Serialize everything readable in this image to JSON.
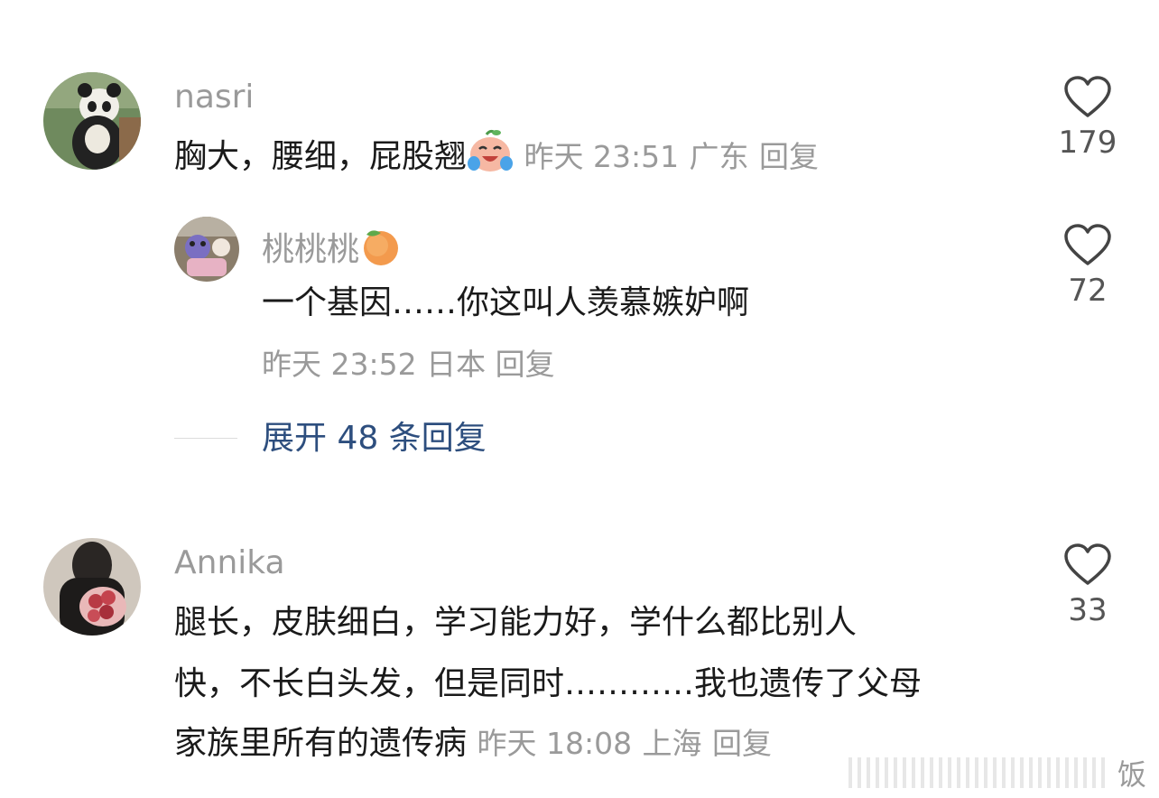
{
  "comments": [
    {
      "username": "nasri",
      "text": "胸大，腰细，屁股翘",
      "emoji": "crying-laugh-emoji",
      "time": "昨天 23:51",
      "location": "广东",
      "reply_label": "回复",
      "likes": "179",
      "replies": [
        {
          "username": "桃桃桃",
          "name_emoji": "peach-emoji",
          "text": "一个基因……你这叫人羡慕嫉妒啊",
          "time": "昨天 23:52",
          "location": "日本",
          "reply_label": "回复",
          "likes": "72"
        }
      ],
      "expand_label": "展开 48 条回复"
    },
    {
      "username": "Annika",
      "text_lines": [
        "腿长，皮肤细白，学习能力好，学什么都比别人",
        "快，不长白头发，但是同时…………我也遗传了父母",
        "家族里所有的遗传病"
      ],
      "time": "昨天 18:08",
      "location": "上海",
      "reply_label": "回复",
      "likes": "33"
    }
  ],
  "watermark": {
    "char": "饭"
  },
  "colors": {
    "secondary_text": "#9a9a9a",
    "link": "#2d4e7e",
    "primary_text": "#1a1a1a"
  }
}
